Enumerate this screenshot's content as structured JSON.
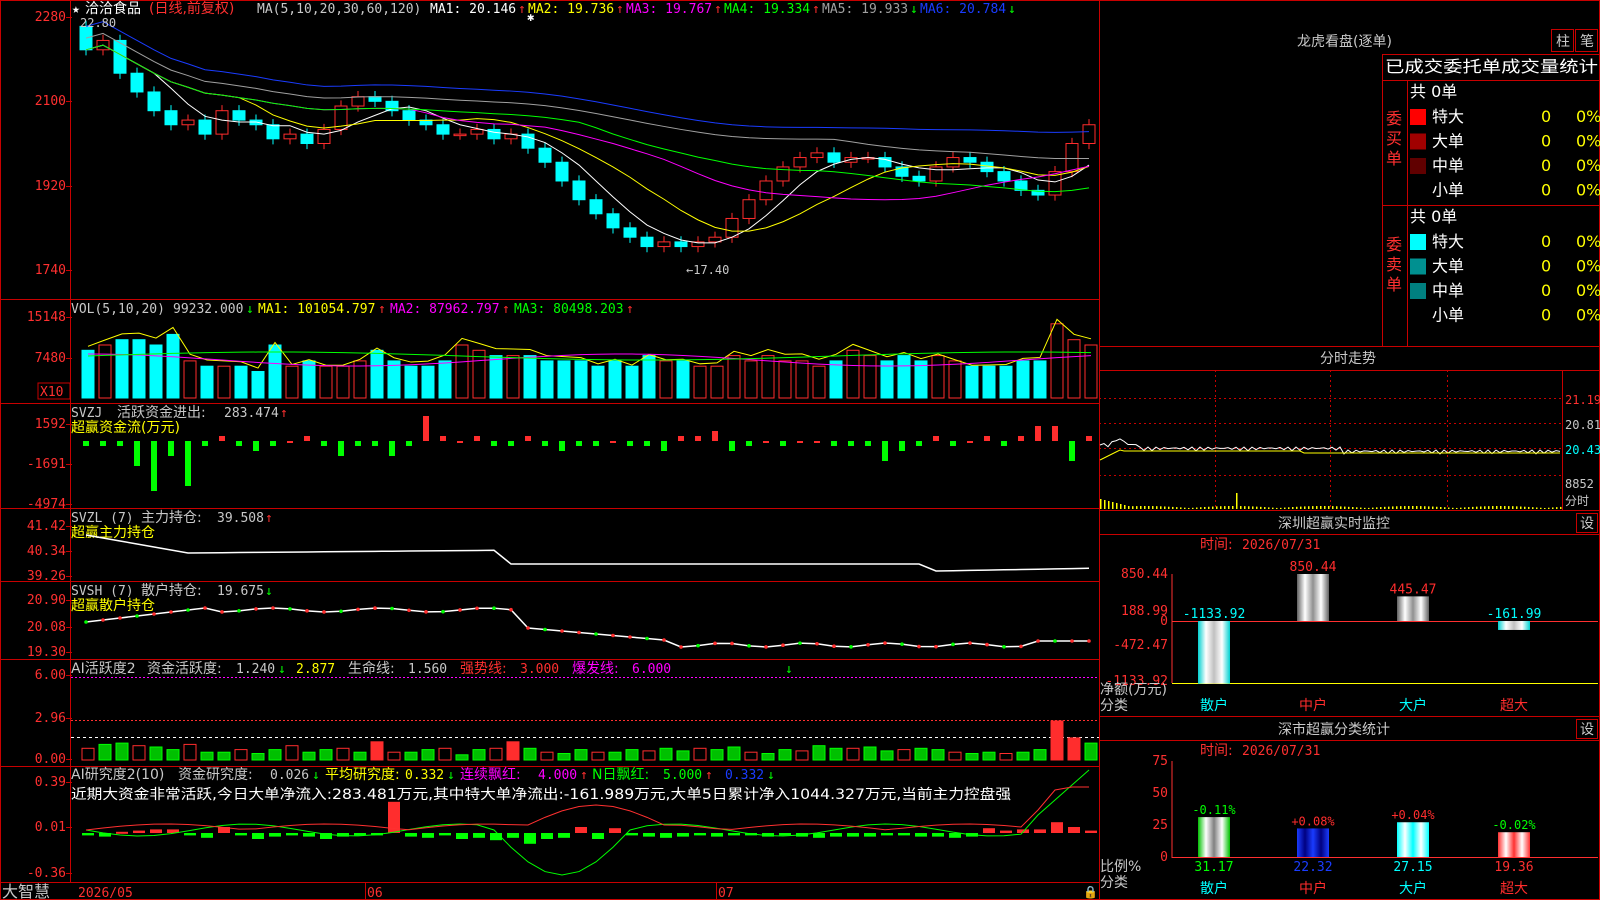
{
  "colors": {
    "up": "#ff2d2d",
    "down": "#00ffff",
    "frame": "#c80000",
    "ma1": "#ffffff",
    "ma2": "#ffff00",
    "ma3": "#ff00ff",
    "ma4": "#00ff00",
    "ma5": "#a0a0a0",
    "ma6": "#1a3cff"
  },
  "main": {
    "stock_name": "洽洽食品",
    "mode": "(日线,前复权)",
    "ma_prefix": "MA(5,10,20,30,60,120)",
    "ma_values": [
      {
        "label": "MA1:",
        "value": "20.146",
        "arrow": "↑"
      },
      {
        "label": "MA2:",
        "value": "19.736",
        "arrow": "↑"
      },
      {
        "label": "MA3:",
        "value": "19.767",
        "arrow": "↑"
      },
      {
        "label": "MA4:",
        "value": "19.334",
        "arrow": "↑"
      },
      {
        "label": "MA5:",
        "value": "19.933",
        "arrow": "↓"
      },
      {
        "label": "MA6:",
        "value": "20.784",
        "arrow": "↓"
      }
    ],
    "y_ticks": [
      "2280",
      "2100",
      "1920",
      "1740"
    ],
    "high_label": "22.80",
    "low_label": "←17.40",
    "star_mark": "✱"
  },
  "vol": {
    "title": "VOL(5,10,20)",
    "value": "99232.000",
    "value_arrow": "↓",
    "mas": [
      {
        "label": "MA1:",
        "value": "101054.797",
        "arrow": "↑"
      },
      {
        "label": "MA2:",
        "value": "87962.797",
        "arrow": "↑"
      },
      {
        "label": "MA3:",
        "value": "80498.203",
        "arrow": "↑"
      }
    ],
    "y_ticks": [
      "15148",
      "7480"
    ],
    "unit": "X10"
  },
  "svzj": {
    "title": "SVZJ",
    "label": "活跃资金进出:",
    "value": "283.474",
    "arrow": "↑",
    "subtitle": "超赢资金流(万元)",
    "y_ticks": [
      "1592",
      "-1691",
      "-4974"
    ]
  },
  "svzl": {
    "title": "SVZL (7)",
    "label": "主力持仓:",
    "value": "39.508",
    "arrow": "↑",
    "subtitle": "超赢主力持仓",
    "y_ticks": [
      "41.42",
      "40.34",
      "39.26"
    ]
  },
  "svsh": {
    "title": "SVSH (7)",
    "label": "散户持仓:",
    "value": "19.675",
    "arrow": "↓",
    "subtitle": "超赢散户持仓",
    "y_ticks": [
      "20.90",
      "20.08",
      "19.30"
    ]
  },
  "ai1": {
    "title": "AI活跃度2",
    "label": "资金活跃度:",
    "value": "1.240",
    "arrow": "↓",
    "second": "2.877",
    "life_label": "生命线:",
    "life": "1.560",
    "strong_label": "强势线:",
    "strong": "3.000",
    "burst_label": "爆发线:",
    "burst": "6.000",
    "y_ticks": [
      "6.00",
      "2.96",
      "0.00"
    ]
  },
  "ai2": {
    "title": "AI研究度2(10)",
    "label": "资金研究度:",
    "value": "0.026",
    "arrow": "↓",
    "avg_label": "平均研究度:",
    "avg": "0.332",
    "avg_arrow": "↓",
    "cont_label": "连续飘红:",
    "cont": "4.000",
    "cont_arrow": "↑",
    "n_label": "N日飘红:",
    "n": "5.000",
    "n_arrow": "↑",
    "last": "0.332",
    "last_arrow": "↓",
    "note": "近期大资金非常活跃,今日大单净流入:283.481万元,其中特大单净流出:-161.989万元,大单5日累计净入1044.327万元,当前主力控盘强",
    "y_ticks": [
      "0.39",
      "0.01",
      "-0.36"
    ]
  },
  "bottom": {
    "brand": "大智慧",
    "dates": [
      "2026/05",
      "06",
      "07"
    ]
  },
  "right": {
    "lhb_title": "龙虎看盘(逐单)",
    "tab1": "柱",
    "tab2": "笔",
    "stat_title": "已成交委托单成交量统计",
    "buy_side": "委买单",
    "sell_side": "委卖单",
    "buy_total": "共 0单",
    "sell_total": "共 0单",
    "buy_rows": [
      {
        "name": "特大",
        "count": "0",
        "pct": "0%",
        "color": "#ff0000"
      },
      {
        "name": "大单",
        "count": "0",
        "pct": "0%",
        "color": "#a00000"
      },
      {
        "name": "中单",
        "count": "0",
        "pct": "0%",
        "color": "#600000"
      },
      {
        "name": "小单",
        "count": "0",
        "pct": "0%",
        "color": ""
      }
    ],
    "sell_rows": [
      {
        "name": "特大",
        "count": "0",
        "pct": "0%",
        "color": "#00ffff"
      },
      {
        "name": "大单",
        "count": "0",
        "pct": "0%",
        "color": "#009090"
      },
      {
        "name": "中单",
        "count": "0",
        "pct": "0%",
        "color": "#008080"
      },
      {
        "name": "小单",
        "count": "0",
        "pct": "0%",
        "color": ""
      }
    ],
    "intraday_title": "分时走势",
    "intraday_ticks": [
      "21.19",
      "20.81",
      "20.43"
    ],
    "intraday_vol": "8852",
    "intraday_unit": "分时",
    "monitor_title": "深圳超赢实时监控",
    "monitor_btn": "设",
    "time_label": "时间:",
    "time_value": "2026/07/31",
    "monitor_y": [
      "850.44",
      "188.99",
      "0",
      "-472.47",
      "-1133.92"
    ],
    "monitor_axis": "净额(万元)",
    "monitor_axis2": "分类",
    "monitor_bars": [
      {
        "cat": "散户",
        "value": -1133.92,
        "label": "-1133.92"
      },
      {
        "cat": "中户",
        "value": 850.44,
        "label": "850.44"
      },
      {
        "cat": "大户",
        "value": 445.47,
        "label": "445.47"
      },
      {
        "cat": "超大",
        "value": -161.99,
        "label": "-161.99"
      }
    ],
    "stats_title": "深市超赢分类统计",
    "stats_btn": "设",
    "stats_y": [
      "75",
      "50",
      "25",
      "0"
    ],
    "stats_axis": "比例%",
    "stats_axis2": "分类",
    "stats_bars": [
      {
        "cat": "散户",
        "value": 31.17,
        "label": "31.17",
        "chg": "-0.11%"
      },
      {
        "cat": "中户",
        "value": 22.32,
        "label": "22.32",
        "chg": "+0.08%"
      },
      {
        "cat": "大户",
        "value": 27.15,
        "label": "27.15",
        "chg": "+0.04%"
      },
      {
        "cat": "超大",
        "value": 19.36,
        "label": "19.36",
        "chg": "-0.02%"
      }
    ]
  }
}
